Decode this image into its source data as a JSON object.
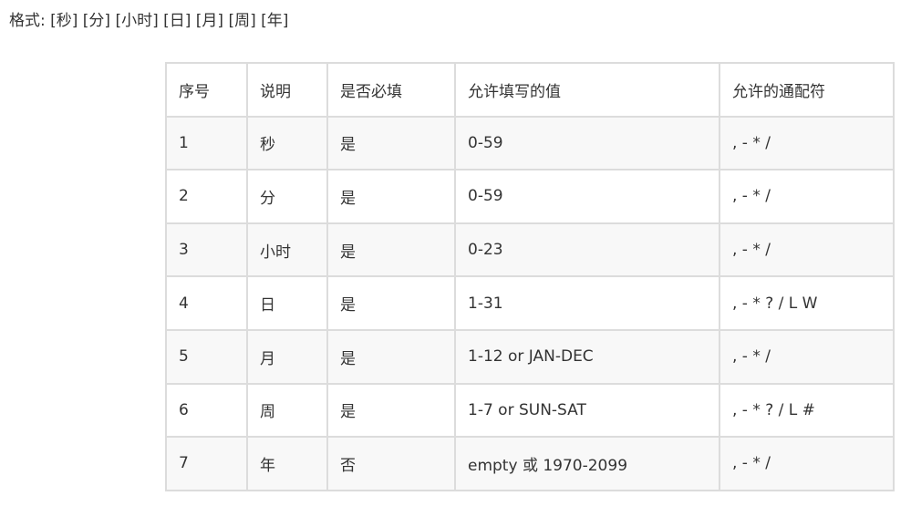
{
  "format_line": "格式: [秒] [分] [小时] [日] [月] [周] [年]",
  "table": {
    "headers": [
      "序号",
      "说明",
      "是否必填",
      "允许填写的值",
      "允许的通配符"
    ],
    "rows": [
      [
        "1",
        "秒",
        "是",
        "0-59",
        ", - * /"
      ],
      [
        "2",
        "分",
        "是",
        "0-59",
        ", - * /"
      ],
      [
        "3",
        "小时",
        "是",
        "0-23",
        ", - * /"
      ],
      [
        "4",
        "日",
        "是",
        "1-31",
        ", - * ? / L W"
      ],
      [
        "5",
        "月",
        "是",
        "1-12 or JAN-DEC",
        ", - * /"
      ],
      [
        "6",
        "周",
        "是",
        "1-7 or SUN-SAT",
        ", - * ? / L #"
      ],
      [
        "7",
        "年",
        "否",
        "empty 或 1970-2099",
        ", - * /"
      ]
    ]
  },
  "colors": {
    "border": "#dcdcdc",
    "stripe": "#f8f8f8",
    "text": "#333333"
  }
}
